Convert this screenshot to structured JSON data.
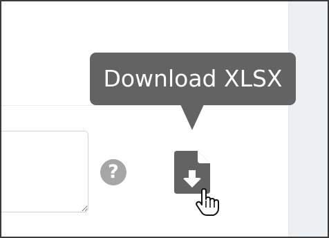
{
  "tooltip": {
    "text": "Download XLSX"
  },
  "help": {
    "glyph": "?",
    "icon": "question-circle-icon"
  },
  "download": {
    "icon": "file-download-icon"
  },
  "cursor": {
    "icon": "pointer-hand-icon"
  },
  "colors": {
    "tooltip_bg": "#636363",
    "icon_gray": "#636363",
    "help_gray": "#a6a6a6",
    "side_panel": "#edf0f2"
  }
}
